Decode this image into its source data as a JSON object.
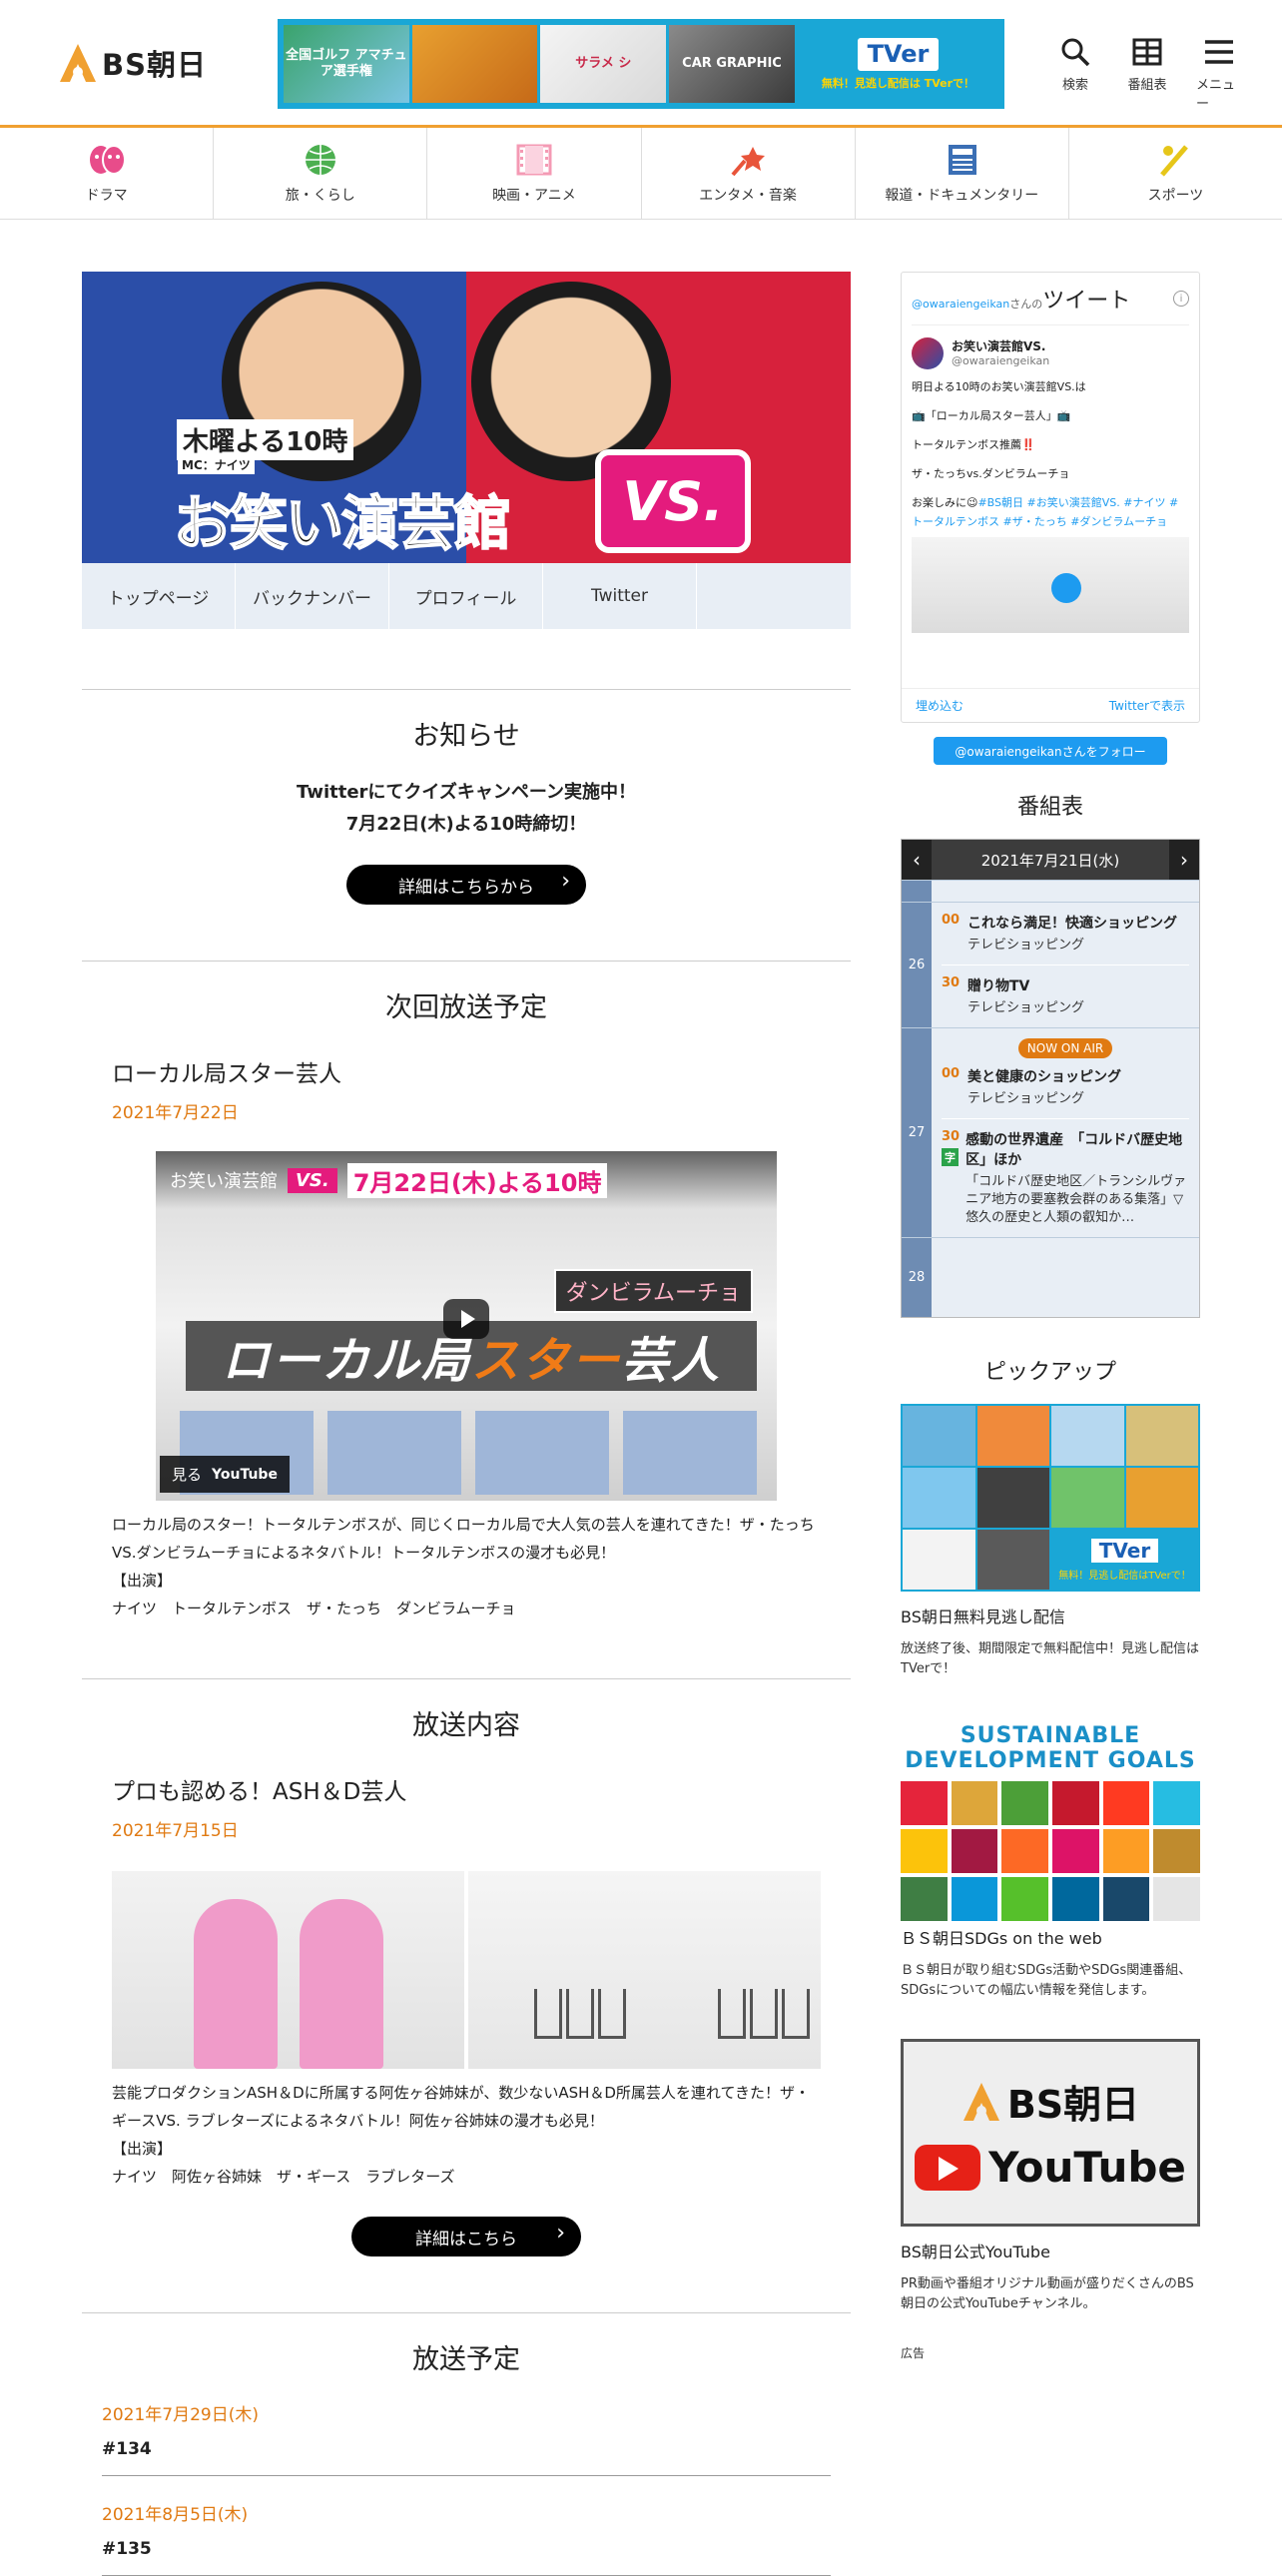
{
  "header": {
    "logo": "BS朝日",
    "banner": {
      "tiles": [
        "全国ゴルフ\nアマチュア選手権",
        "",
        "サラメ\nシ",
        "CAR GRAPHIC",
        ""
      ],
      "tver_logo": "TVer",
      "tver_note": "無料！見逃し配信は TVerで！"
    },
    "icons": [
      {
        "label": "検索",
        "icon": "search-icon"
      },
      {
        "label": "番組表",
        "icon": "schedule-icon"
      },
      {
        "label": "メニュー",
        "icon": "menu-icon"
      }
    ]
  },
  "categories": [
    {
      "label": "ドラマ",
      "icon": "drama-icon",
      "color": "#e84c8a"
    },
    {
      "label": "旅・くらし",
      "icon": "globe-icon",
      "color": "#4caf50"
    },
    {
      "label": "映画・アニメ",
      "icon": "film-icon",
      "color": "#f49ab4"
    },
    {
      "label": "エンタメ・音楽",
      "icon": "microphone-icon",
      "color": "#e8543a"
    },
    {
      "label": "報道・ドキュメンタリー",
      "icon": "newspaper-icon",
      "color": "#3b6fb5"
    },
    {
      "label": "スポーツ",
      "icon": "sports-icon",
      "color": "#e6c619"
    }
  ],
  "hero": {
    "time": "木曜よる10時",
    "mc": "MC：ナイツ",
    "title": "お笑い演芸館",
    "vs": "VS."
  },
  "program_tabs": [
    "トップページ",
    "バックナンバー",
    "プロフィール",
    "Twitter"
  ],
  "notice": {
    "heading": "お知らせ",
    "line1": "Twitterにてクイズキャンペーン実施中！",
    "line2": "7月22日(木)よる10時締切！",
    "button": "詳細はこちらから"
  },
  "next": {
    "heading": "次回放送予定",
    "title": "ローカル局スター芸人",
    "date": "2021年7月22日",
    "video": {
      "top_title": "お笑い演芸館",
      "top_vs": "VS.",
      "top_date": "7月22日(木)よる10時",
      "band_a": "ローカル局",
      "band_b": "スター",
      "band_c": "芸人",
      "tag": "ダンビラムーチョ",
      "watch": "見る",
      "yt": "YouTube"
    },
    "desc1": "ローカル局のスター！トータルテンボスが、同じくローカル局で大人気の芸人を連れてきた！ザ・たっちVS.ダンビラムーチョによるネタバトル！トータルテンボスの漫才も必見！",
    "cast_label": "【出演】",
    "cast": "ナイツ　トータルテンボス　ザ・たっち　ダンビラムーチョ"
  },
  "content": {
    "heading": "放送内容",
    "title": "プロも認める！ASH＆D芸人",
    "date": "2021年7月15日",
    "desc1": "芸能プロダクションASH＆Dに所属する阿佐ヶ谷姉妹が、数少ないASH＆D所属芸人を連れてきた！ザ・ギースVS. ラブレターズによるネタバトル！阿佐ヶ谷姉妹の漫才も必見！",
    "cast_label": "【出演】",
    "cast": "ナイツ　阿佐ヶ谷姉妹　ザ・ギース　ラブレターズ",
    "button": "詳細はこちら"
  },
  "upcoming": {
    "heading": "放送予定",
    "items": [
      {
        "date": "2021年7月29日(木)",
        "ep": "#134"
      },
      {
        "date": "2021年8月5日(木)",
        "ep": "#135"
      }
    ]
  },
  "twitter": {
    "account": "@owaraiengeikan",
    "account_suffix": "さんの",
    "label": "ツイート",
    "user_name": "お笑い演芸館VS.",
    "user_handle": "@owaraiengeikan",
    "body": [
      "明日よる10時のお笑い演芸館VS.は",
      "📺「ローカル局スター芸人」📺",
      "トータルテンボス推薦‼️",
      "ザ・たっちvs.ダンビラムーチョ"
    ],
    "tail_prefix": "お楽しみに😉",
    "tail_tags": "#BS朝日 #お笑い演芸館VS. #ナイツ #トータルテンボス #ザ・たっち #ダンビラムーチョ",
    "embed": "埋め込む",
    "view": "Twitterで表示",
    "follow": "@owaraiengeikanさんをフォロー"
  },
  "schedule": {
    "heading": "番組表",
    "date": "2021年7月21日(水)",
    "rows": [
      {
        "hour": "26",
        "progs": [
          {
            "min": "00",
            "title": "これなら満足！快適ショッピング",
            "sub": "テレビショッピング"
          },
          {
            "min": "30",
            "title": "贈り物TV",
            "sub": "テレビショッピング"
          }
        ]
      },
      {
        "hour": "27",
        "onair": "NOW ON AIR",
        "progs": [
          {
            "min": "00",
            "title": "美と健康のショッピング",
            "sub": "テレビショッピング"
          },
          {
            "min": "30",
            "title": "感動の世界遺産　「コルドバ歴史地区」ほか",
            "sub": "「コルドバ歴史地区／トランシルヴァニア地方の要塞教会群のある集落」▽悠久の歴史と人類の叡知か…",
            "tag": "字"
          }
        ]
      },
      {
        "hour": "28",
        "progs": []
      }
    ]
  },
  "pickup": {
    "heading": "ピックアップ",
    "tver": "TVer",
    "tver_note": "無料！見逃し配信はTVerで！",
    "title": "BS朝日無料見逃し配信",
    "desc": "放送終了後、期間限定で無料配信中！見逃し配信はTVerで！"
  },
  "sdgs": {
    "logo_text": "SUSTAINABLE DEVELOPMENT GOALS",
    "colors": [
      "#e5243b",
      "#dda63a",
      "#4c9f38",
      "#c5192d",
      "#ff3a21",
      "#26bde2",
      "#fcc30b",
      "#a21942",
      "#fd6925",
      "#dd1367",
      "#fd9d24",
      "#bf8b2e",
      "#3f7e44",
      "#0a97d9",
      "#56c02b",
      "#00689d",
      "#19486a",
      "#e5e5e5"
    ],
    "title": "ＢＳ朝日SDGs on the web",
    "desc": "ＢＳ朝日が取り組むSDGs活動やSDGs関連番組、SDGsについての幅広い情報を発信します。"
  },
  "youtube": {
    "logo": "BS朝日",
    "yt": "YouTube",
    "title": "BS朝日公式YouTube",
    "desc": "PR動画や番組オリジナル動画が盛りだくさんのBS朝日の公式YouTubeチャンネル。"
  },
  "ad": "広告"
}
